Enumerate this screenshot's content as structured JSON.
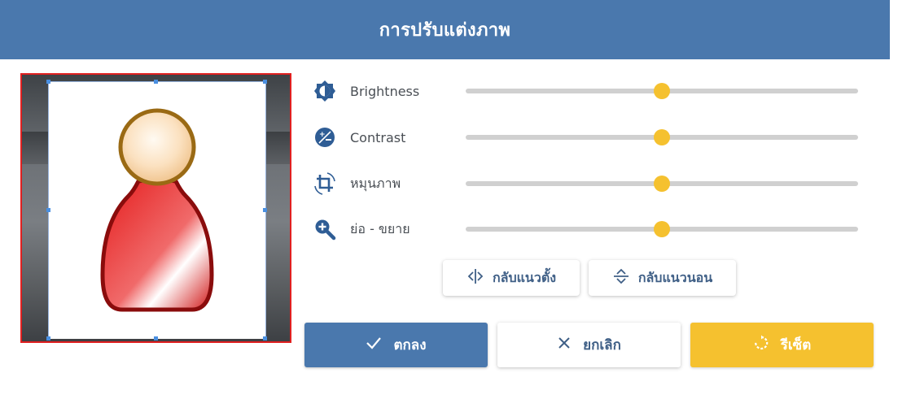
{
  "dialog": {
    "title": "การปรับแต่งภาพ"
  },
  "preview": {
    "frame_color": "#e02020",
    "image_icon": "user-avatar-icon"
  },
  "sliders": [
    {
      "label": "Brightness",
      "icon": "brightness-icon",
      "value": 50
    },
    {
      "label": "Contrast",
      "icon": "contrast-icon",
      "value": 50
    },
    {
      "label": "หมุนภาพ",
      "icon": "rotate-icon",
      "value": 50
    },
    {
      "label": "ย่อ - ขยาย",
      "icon": "zoom-in-icon",
      "value": 50
    }
  ],
  "flip": {
    "vertical_label": "กลับแนวตั้ง",
    "horizontal_label": "กลับแนวนอน"
  },
  "actions": {
    "ok_label": "ตกลง",
    "cancel_label": "ยกเลิก",
    "reset_label": "รีเซ็ต"
  },
  "colors": {
    "primary": "#4a78ad",
    "accent": "#f5c12f",
    "track": "#d0d0d0"
  }
}
